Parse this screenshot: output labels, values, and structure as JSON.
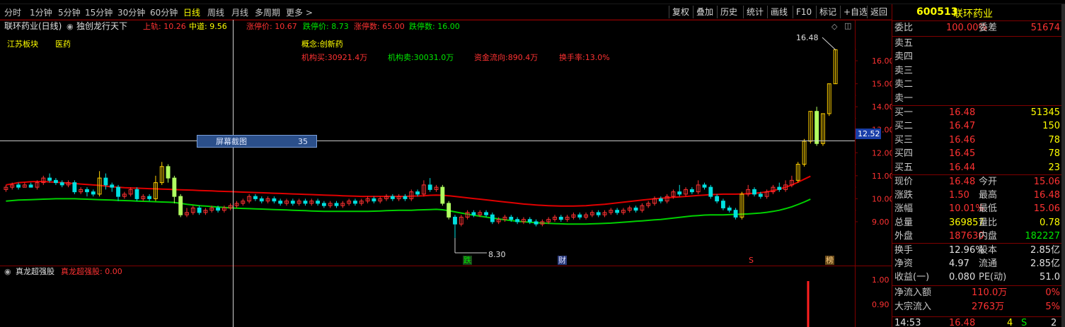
{
  "toolbar": {
    "periods": [
      "分时",
      "1分钟",
      "5分钟",
      "15分钟",
      "30分钟",
      "60分钟",
      "日线",
      "周线",
      "月线",
      "多周期",
      "更多 >"
    ],
    "active_index": 6,
    "right_buttons": [
      "复权",
      "叠加",
      "历史",
      "统计",
      "画线",
      "F10",
      "标记",
      "+自选",
      "返回"
    ]
  },
  "info_bar": {
    "stock_period": "联环药业(日线)",
    "indicator": "独创龙行天下",
    "upper_label": "上轨: 10.26",
    "mid_label": "中道: 9.56",
    "limit_up_price": "涨停价: 10.67",
    "limit_down_price": "跌停价: 8.73",
    "limit_up_count": "涨停数: 65.00",
    "limit_down_count": "跌停数: 16.00"
  },
  "tags": {
    "region": "江苏板块",
    "industry": "医药",
    "concept": "概念:创新药"
  },
  "fund_flow": {
    "inst_buy": "机构买:30921.4万",
    "inst_sell": "机构卖:30031.0万",
    "net_flow": "资金流向:890.4万",
    "turnover": "换手率:13.0%"
  },
  "tooltip": {
    "name": "屏幕截图",
    "value": "35"
  },
  "chart_labels": {
    "high_mark": "16.48",
    "low_mark": "8.30",
    "crosshair_price": "12.52",
    "events": [
      "跌",
      "财",
      "S",
      "榜"
    ]
  },
  "sub_panel": {
    "indicator": "真龙超强股",
    "value_label": "真龙超强股: 0.00",
    "axis": [
      "1.00",
      "0.90"
    ]
  },
  "chart_data": {
    "type": "candlestick",
    "title": "联环药业(日线)",
    "y_axis_ticks": [
      9.0,
      10.0,
      11.0,
      12.0,
      13.0,
      14.0,
      15.0,
      16.0
    ],
    "ylim": [
      8.2,
      16.8
    ],
    "candles": [
      [
        10.4,
        10.5,
        10.3,
        10.6
      ],
      [
        10.5,
        10.6,
        10.4,
        10.7
      ],
      [
        10.6,
        10.5,
        10.4,
        10.7
      ],
      [
        10.5,
        10.6,
        10.5,
        10.7
      ],
      [
        10.6,
        10.5,
        10.5,
        10.7
      ],
      [
        10.5,
        10.7,
        10.4,
        10.8
      ],
      [
        10.7,
        10.9,
        10.6,
        11.0
      ],
      [
        10.9,
        10.8,
        10.7,
        11.1
      ],
      [
        10.8,
        10.7,
        10.6,
        10.9
      ],
      [
        10.7,
        10.6,
        10.5,
        10.8
      ],
      [
        10.6,
        10.7,
        10.5,
        10.8
      ],
      [
        10.7,
        10.3,
        10.2,
        10.8
      ],
      [
        10.3,
        10.4,
        10.2,
        10.5
      ],
      [
        10.4,
        10.3,
        10.1,
        10.5
      ],
      [
        10.3,
        10.2,
        10.1,
        10.4
      ],
      [
        10.2,
        10.9,
        10.1,
        11.2
      ],
      [
        10.9,
        10.6,
        10.4,
        11.1
      ],
      [
        10.6,
        10.5,
        10.3,
        10.7
      ],
      [
        10.5,
        10.1,
        9.9,
        10.6
      ],
      [
        10.1,
        10.2,
        10.0,
        10.3
      ],
      [
        10.2,
        10.4,
        10.1,
        10.5
      ],
      [
        10.4,
        10.0,
        9.9,
        10.5
      ],
      [
        10.0,
        10.1,
        9.9,
        10.2
      ],
      [
        10.1,
        10.0,
        9.9,
        10.2
      ],
      [
        10.0,
        10.7,
        9.9,
        11.0
      ],
      [
        10.7,
        11.4,
        10.6,
        11.6
      ],
      [
        11.4,
        10.9,
        10.7,
        11.5
      ],
      [
        10.9,
        10.1,
        9.8,
        11.0
      ],
      [
        10.1,
        9.3,
        9.2,
        10.2
      ],
      [
        9.3,
        9.4,
        9.2,
        9.6
      ],
      [
        9.4,
        9.6,
        9.3,
        9.7
      ],
      [
        9.6,
        9.4,
        9.3,
        9.7
      ],
      [
        9.4,
        9.5,
        9.3,
        9.6
      ],
      [
        9.5,
        9.6,
        9.4,
        9.7
      ],
      [
        9.6,
        9.5,
        9.4,
        9.7
      ],
      [
        9.5,
        9.6,
        9.4,
        9.7
      ],
      [
        9.6,
        9.7,
        9.5,
        9.8
      ],
      [
        9.7,
        9.8,
        9.6,
        9.9
      ],
      [
        9.8,
        9.9,
        9.7,
        10.0
      ],
      [
        9.9,
        10.1,
        9.8,
        10.2
      ],
      [
        10.1,
        10.0,
        9.9,
        10.2
      ],
      [
        10.0,
        9.9,
        9.8,
        10.1
      ],
      [
        9.9,
        10.0,
        9.8,
        10.1
      ],
      [
        10.0,
        9.9,
        9.8,
        10.1
      ],
      [
        9.9,
        9.8,
        9.7,
        10.0
      ],
      [
        9.8,
        9.9,
        9.7,
        10.0
      ],
      [
        9.9,
        9.8,
        9.7,
        10.0
      ],
      [
        9.8,
        9.9,
        9.7,
        10.0
      ],
      [
        9.9,
        9.8,
        9.7,
        10.0
      ],
      [
        9.8,
        9.9,
        9.7,
        10.0
      ],
      [
        9.9,
        9.8,
        9.7,
        10.0
      ],
      [
        9.8,
        9.7,
        9.6,
        9.9
      ],
      [
        9.7,
        9.8,
        9.6,
        9.9
      ],
      [
        9.8,
        9.7,
        9.6,
        9.9
      ],
      [
        9.7,
        9.8,
        9.6,
        9.9
      ],
      [
        9.8,
        9.9,
        9.7,
        10.0
      ],
      [
        9.9,
        9.8,
        9.7,
        10.0
      ],
      [
        9.8,
        9.9,
        9.7,
        10.0
      ],
      [
        9.9,
        10.0,
        9.8,
        10.1
      ],
      [
        10.0,
        9.9,
        9.8,
        10.1
      ],
      [
        9.9,
        10.0,
        9.8,
        10.1
      ],
      [
        10.0,
        10.1,
        9.9,
        10.2
      ],
      [
        10.1,
        10.0,
        9.9,
        10.2
      ],
      [
        10.0,
        10.1,
        9.9,
        10.2
      ],
      [
        10.1,
        10.0,
        9.9,
        10.2
      ],
      [
        10.0,
        10.3,
        9.9,
        10.4
      ],
      [
        10.3,
        10.2,
        10.1,
        10.4
      ],
      [
        10.2,
        10.6,
        10.1,
        10.8
      ],
      [
        10.6,
        10.4,
        10.3,
        10.9
      ],
      [
        10.4,
        10.5,
        10.3,
        10.6
      ],
      [
        10.5,
        9.8,
        9.7,
        10.6
      ],
      [
        9.8,
        9.2,
        9.1,
        9.9
      ],
      [
        9.2,
        8.9,
        8.3,
        9.3
      ],
      [
        8.9,
        9.2,
        8.8,
        9.3
      ],
      [
        9.2,
        9.4,
        9.1,
        9.5
      ],
      [
        9.4,
        9.3,
        9.2,
        9.5
      ],
      [
        9.3,
        9.4,
        9.2,
        9.5
      ],
      [
        9.4,
        9.3,
        9.2,
        9.5
      ],
      [
        9.3,
        9.0,
        8.9,
        9.4
      ],
      [
        9.0,
        9.1,
        8.9,
        9.2
      ],
      [
        9.1,
        9.2,
        9.0,
        9.3
      ],
      [
        9.2,
        9.1,
        9.0,
        9.3
      ],
      [
        9.1,
        9.0,
        8.9,
        9.2
      ],
      [
        9.0,
        9.1,
        8.9,
        9.2
      ],
      [
        9.1,
        9.0,
        8.9,
        9.2
      ],
      [
        9.0,
        8.9,
        8.8,
        9.1
      ],
      [
        8.9,
        9.0,
        8.8,
        9.1
      ],
      [
        9.0,
        9.1,
        8.9,
        9.2
      ],
      [
        9.1,
        9.2,
        9.0,
        9.3
      ],
      [
        9.2,
        9.1,
        9.0,
        9.3
      ],
      [
        9.1,
        9.2,
        9.0,
        9.3
      ],
      [
        9.2,
        9.3,
        9.1,
        9.4
      ],
      [
        9.3,
        9.2,
        9.1,
        9.4
      ],
      [
        9.2,
        9.3,
        9.1,
        9.4
      ],
      [
        9.3,
        9.4,
        9.2,
        9.5
      ],
      [
        9.4,
        9.3,
        9.2,
        9.5
      ],
      [
        9.3,
        9.4,
        9.2,
        9.5
      ],
      [
        9.4,
        9.5,
        9.3,
        9.6
      ],
      [
        9.5,
        9.4,
        9.3,
        9.6
      ],
      [
        9.4,
        9.5,
        9.3,
        9.6
      ],
      [
        9.5,
        9.6,
        9.4,
        9.7
      ],
      [
        9.6,
        9.5,
        9.4,
        9.7
      ],
      [
        9.5,
        9.7,
        9.4,
        9.8
      ],
      [
        9.7,
        9.8,
        9.6,
        9.9
      ],
      [
        9.8,
        10.0,
        9.7,
        10.1
      ],
      [
        10.0,
        9.9,
        9.8,
        10.1
      ],
      [
        9.9,
        10.1,
        9.8,
        10.2
      ],
      [
        10.1,
        10.3,
        10.0,
        10.4
      ],
      [
        10.3,
        10.2,
        10.1,
        10.6
      ],
      [
        10.2,
        10.4,
        10.1,
        10.5
      ],
      [
        10.4,
        10.3,
        10.2,
        10.5
      ],
      [
        10.3,
        10.6,
        10.2,
        10.8
      ],
      [
        10.6,
        10.5,
        10.4,
        10.7
      ],
      [
        10.5,
        10.1,
        10.0,
        10.6
      ],
      [
        10.1,
        9.9,
        9.8,
        10.2
      ],
      [
        9.9,
        9.6,
        9.5,
        10.0
      ],
      [
        9.6,
        9.5,
        9.4,
        9.7
      ],
      [
        9.5,
        9.2,
        9.1,
        9.6
      ],
      [
        9.2,
        10.2,
        9.1,
        10.3
      ],
      [
        10.2,
        10.4,
        10.1,
        10.6
      ],
      [
        10.4,
        10.2,
        10.1,
        10.5
      ],
      [
        10.2,
        10.1,
        10.0,
        10.3
      ],
      [
        10.1,
        10.3,
        10.0,
        10.4
      ],
      [
        10.3,
        10.5,
        10.2,
        10.6
      ],
      [
        10.5,
        10.4,
        10.3,
        10.7
      ],
      [
        10.4,
        10.6,
        10.3,
        10.8
      ],
      [
        10.6,
        10.8,
        10.5,
        11.0
      ],
      [
        10.8,
        11.5,
        10.7,
        11.6
      ],
      [
        11.5,
        12.5,
        11.4,
        12.6
      ],
      [
        12.5,
        13.8,
        12.4,
        13.8
      ],
      [
        13.8,
        12.4,
        12.3,
        14.0
      ],
      [
        12.4,
        13.7,
        12.3,
        13.7
      ],
      [
        13.7,
        15.0,
        13.6,
        15.0
      ],
      [
        15.0,
        16.48,
        15.0,
        16.48
      ]
    ],
    "upper_band": [
      10.6,
      10.65,
      10.7,
      10.72,
      10.74,
      10.75,
      10.75,
      10.73,
      10.72,
      10.7,
      10.68,
      10.66,
      10.64,
      10.62,
      10.6,
      10.58,
      10.55,
      10.52,
      10.5,
      10.48,
      10.47,
      10.46,
      10.45,
      10.44,
      10.43,
      10.42,
      10.41,
      10.4,
      10.39,
      10.38,
      10.37,
      10.36,
      10.35,
      10.34,
      10.33,
      10.32,
      10.31,
      10.3,
      10.29,
      10.28,
      10.27,
      10.26,
      10.25,
      10.24,
      10.23,
      10.22,
      10.21,
      10.2,
      10.19,
      10.18,
      10.17,
      10.16,
      10.15,
      10.14,
      10.13,
      10.12,
      10.11,
      10.1,
      10.1,
      10.1,
      10.1,
      10.1,
      10.1,
      10.1,
      10.1,
      10.11,
      10.12,
      10.13,
      10.15,
      10.16,
      10.15,
      10.13,
      10.1,
      10.07,
      10.04,
      10.01,
      9.98,
      9.95,
      9.92,
      9.89,
      9.86,
      9.83,
      9.8,
      9.77,
      9.75,
      9.73,
      9.71,
      9.7,
      9.69,
      9.68,
      9.68,
      9.68,
      9.69,
      9.7,
      9.72,
      9.74,
      9.76,
      9.79,
      9.82,
      9.85,
      9.88,
      9.91,
      9.94,
      9.97,
      10.0,
      10.02,
      10.04,
      10.06,
      10.08,
      10.1,
      10.12,
      10.14,
      10.16,
      10.18,
      10.19,
      10.2,
      10.2,
      10.2,
      10.21,
      10.22,
      10.24,
      10.26,
      10.3,
      10.35,
      10.42,
      10.5,
      10.6,
      10.72,
      10.85,
      10.98
    ],
    "mid_band": [
      9.9,
      9.92,
      9.94,
      9.95,
      9.96,
      9.97,
      9.98,
      9.99,
      10.0,
      10.0,
      10.0,
      10.0,
      9.99,
      9.98,
      9.97,
      9.96,
      9.95,
      9.94,
      9.93,
      9.92,
      9.91,
      9.9,
      9.89,
      9.88,
      9.87,
      9.86,
      9.85,
      9.84,
      9.8,
      9.76,
      9.73,
      9.7,
      9.68,
      9.66,
      9.64,
      9.62,
      9.6,
      9.59,
      9.58,
      9.57,
      9.56,
      9.55,
      9.54,
      9.53,
      9.52,
      9.51,
      9.5,
      9.49,
      9.48,
      9.47,
      9.46,
      9.45,
      9.45,
      9.45,
      9.45,
      9.45,
      9.45,
      9.45,
      9.45,
      9.46,
      9.47,
      9.48,
      9.49,
      9.5,
      9.5,
      9.5,
      9.51,
      9.52,
      9.53,
      9.54,
      9.52,
      9.48,
      9.43,
      9.38,
      9.33,
      9.28,
      9.24,
      9.2,
      9.16,
      9.12,
      9.08,
      9.05,
      9.02,
      9.0,
      8.98,
      8.96,
      8.94,
      8.93,
      8.92,
      8.91,
      8.9,
      8.9,
      8.9,
      8.9,
      8.91,
      8.92,
      8.93,
      8.94,
      8.96,
      8.98,
      9.0,
      9.02,
      9.04,
      9.06,
      9.08,
      9.1,
      9.13,
      9.16,
      9.19,
      9.22,
      9.25,
      9.27,
      9.29,
      9.3,
      9.3,
      9.3,
      9.31,
      9.32,
      9.33,
      9.34,
      9.36,
      9.38,
      9.41,
      9.45,
      9.5,
      9.57,
      9.65,
      9.75,
      9.86,
      9.98
    ],
    "sub_values": {
      "ylim": [
        0.85,
        1.05
      ]
    }
  },
  "quote": {
    "code": "600513",
    "name": "联环药业",
    "weibi_label": "委比",
    "weibi": "100.00%",
    "weicha_label": "委差",
    "weicha": "51674",
    "asks": [
      {
        "label": "卖五",
        "price": "",
        "vol": ""
      },
      {
        "label": "卖四",
        "price": "",
        "vol": ""
      },
      {
        "label": "卖三",
        "price": "",
        "vol": ""
      },
      {
        "label": "卖二",
        "price": "",
        "vol": ""
      },
      {
        "label": "卖一",
        "price": "",
        "vol": ""
      }
    ],
    "bids": [
      {
        "label": "买一",
        "price": "16.48",
        "vol": "51345"
      },
      {
        "label": "买二",
        "price": "16.47",
        "vol": "150"
      },
      {
        "label": "买三",
        "price": "16.46",
        "vol": "78"
      },
      {
        "label": "买四",
        "price": "16.45",
        "vol": "78"
      },
      {
        "label": "买五",
        "price": "16.44",
        "vol": "23"
      }
    ],
    "stats": [
      {
        "l1": "现价",
        "v1": "16.48",
        "l2": "今开",
        "v2": "15.06"
      },
      {
        "l1": "涨跌",
        "v1": "1.50",
        "l2": "最高",
        "v2": "16.48"
      },
      {
        "l1": "涨幅",
        "v1": "10.01%",
        "l2": "最低",
        "v2": "15.06"
      },
      {
        "l1": "总量",
        "v1": "369857",
        "l2": "量比",
        "v2": "0.78"
      },
      {
        "l1": "外盘",
        "v1": "187630",
        "l2": "内盘",
        "v2": "182227"
      }
    ],
    "fundamentals": [
      {
        "l1": "换手",
        "v1": "12.96%",
        "l2": "股本",
        "v2": "2.85亿"
      },
      {
        "l1": "净资",
        "v1": "4.97",
        "l2": "流通",
        "v2": "2.85亿"
      },
      {
        "l1": "收益(一)",
        "v1": "0.080",
        "l2": "PE(动)",
        "v2": "51.0"
      }
    ],
    "flows": [
      {
        "label": "净流入额",
        "value": "110.0万",
        "pct": "0%"
      },
      {
        "label": "大宗流入",
        "value": "2763万",
        "pct": "5%"
      }
    ],
    "tick": {
      "time": "14:53",
      "price": "16.48",
      "vol": "4",
      "side": "S",
      "n": "2"
    }
  },
  "colors": {
    "up": "#ff3232",
    "down": "#00e0e0",
    "mid": "#00d000",
    "upper": "#e00000",
    "yellow": "#ffff00",
    "green": "#00e600"
  }
}
